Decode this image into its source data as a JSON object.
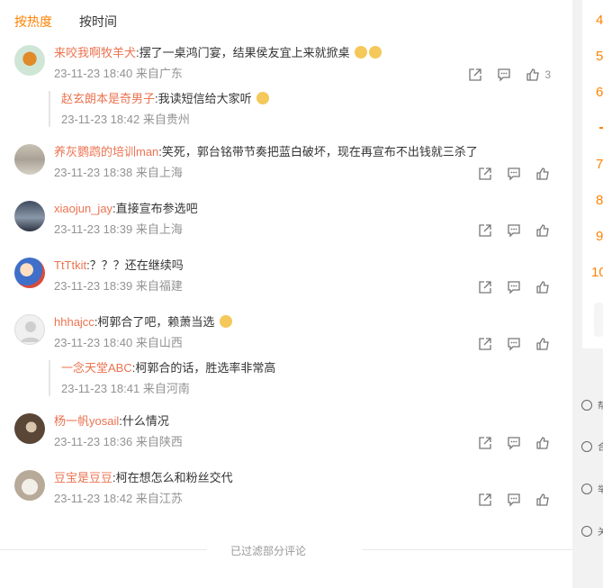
{
  "tabs": [
    {
      "label": "按热度",
      "active": true
    },
    {
      "label": "按时间",
      "active": false
    }
  ],
  "comments": [
    {
      "user": "来咬我啊牧羊犬",
      "text": ":摆了一桌鸿门宴，结果侯友宜上来就掀桌",
      "meta": "23-11-23 18:40 来自广东",
      "like_count": "3",
      "reply": {
        "user": "赵玄朗本是奇男子",
        "text": ":我读短信给大家听",
        "meta": "23-11-23 18:42 来自贵州"
      }
    },
    {
      "user": "养灰鹦鹉的培训man",
      "text": ":笑死，郭台铭带节奏把蓝白破坏，现在再宣布不出钱就三杀了",
      "meta": "23-11-23 18:38 来自上海"
    },
    {
      "user": "xiaojun_jay",
      "text": ":直接宣布参选吧",
      "meta": "23-11-23 18:39 来自上海"
    },
    {
      "user": "TtTtkit",
      "text": ":？？？还在继续吗",
      "meta": "23-11-23 18:39 来自福建"
    },
    {
      "user": "hhhajcc",
      "text": ":柯郭合了吧，赖萧当选",
      "meta": "23-11-23 18:40 来自山西",
      "reply": {
        "user": "一念天堂ABC",
        "text": ":柯郭合的话，胜选率非常高",
        "meta": "23-11-23 18:41 来自河南"
      }
    },
    {
      "user": "杨一帆yosail",
      "text": ":什么情况",
      "meta": "23-11-23 18:36 来自陕西"
    },
    {
      "user": "豆宝是豆豆",
      "text": ":柯在想怎么和粉丝交代",
      "meta": "23-11-23 18:42 来自江苏"
    }
  ],
  "footer": {
    "text": "已过滤部分评论"
  },
  "side_numbers": [
    "4",
    "5",
    "6",
    "7",
    "8",
    "9",
    "10"
  ],
  "side_links": [
    {
      "label": "帮",
      "icon": "help-icon"
    },
    {
      "label": "合",
      "icon": "cooperation-icon"
    },
    {
      "label": "举",
      "icon": "report-icon"
    },
    {
      "label": "关",
      "icon": "about-icon"
    }
  ],
  "icons": {
    "share": "share-icon",
    "comment": "comment-icon",
    "like": "like-icon"
  },
  "colors": {
    "accent": "#ff8200",
    "username": "#eb7350",
    "meta": "#939393"
  }
}
